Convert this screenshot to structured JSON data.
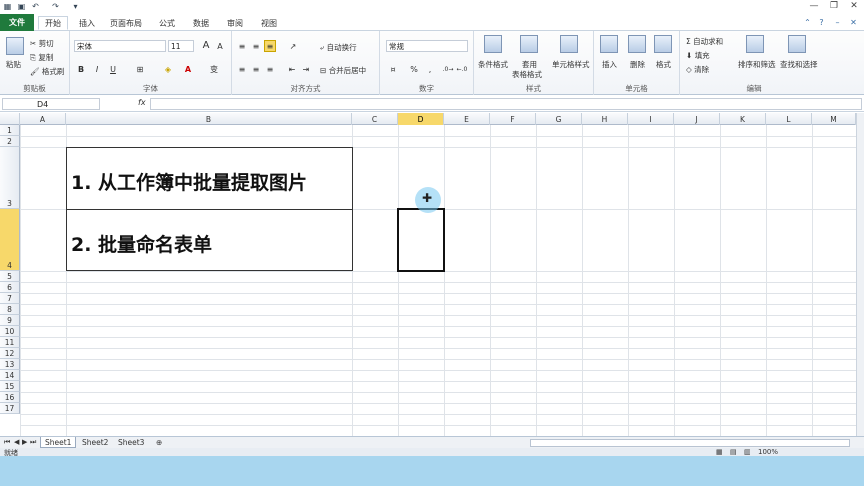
{
  "qat": {
    "dropdown_glyph": "▾"
  },
  "window": {
    "minimize": "—",
    "restore": "❐",
    "close": "✕"
  },
  "tabs": [
    {
      "label": "文件"
    },
    {
      "label": "开始"
    },
    {
      "label": "插入"
    },
    {
      "label": "页面布局"
    },
    {
      "label": "公式"
    },
    {
      "label": "数据"
    },
    {
      "label": "审阅"
    },
    {
      "label": "视图"
    }
  ],
  "ribbon": {
    "clipboard": {
      "paste": "粘贴",
      "cut": "剪切",
      "copy": "复制",
      "format_painter": "格式刷",
      "label": "剪贴板"
    },
    "font": {
      "name": "宋体",
      "size": "11",
      "grow": "A",
      "shrink": "A",
      "bold": "B",
      "italic": "I",
      "underline": "U",
      "label": "字体",
      "phonetic": "变"
    },
    "alignment": {
      "wrap": "自动换行",
      "merge": "合并后居中",
      "label": "对齐方式"
    },
    "number": {
      "format": "常规",
      "percent": "%",
      "comma": ",",
      "label": "数字"
    },
    "styles": {
      "conditional": "条件格式",
      "table_line1": "套用",
      "table_line2": "表格格式",
      "cell_styles": "单元格样式",
      "label": "样式"
    },
    "cells": {
      "insert": "插入",
      "delete": "删除",
      "format": "格式",
      "label": "单元格"
    },
    "editing": {
      "autosum": "自动求和",
      "fill": "填充",
      "clear": "清除",
      "sort": "排序和筛选",
      "find": "查找和选择",
      "label": "编辑"
    }
  },
  "formula_bar": {
    "cell_ref": "D4",
    "fx": "fx",
    "value": ""
  },
  "columns": [
    "A",
    "B",
    "C",
    "D",
    "E",
    "F",
    "G",
    "H",
    "I",
    "J",
    "K",
    "L",
    "M"
  ],
  "rows": [
    "1",
    "2",
    "3",
    "4",
    "5",
    "6",
    "7",
    "8",
    "9",
    "10",
    "11",
    "12",
    "13",
    "14",
    "15",
    "16",
    "17"
  ],
  "selected": {
    "column": "D",
    "row": "4"
  },
  "content": {
    "item1": "1. 从工作簿中批量提取图片",
    "item2": "2. 批量命名表单"
  },
  "sheets": [
    {
      "label": "Sheet1"
    },
    {
      "label": "Sheet2"
    },
    {
      "label": "Sheet3"
    }
  ],
  "status": {
    "ready": "就绪",
    "zoom": "100%"
  },
  "colors": {
    "file_tab": "#1f7a3c",
    "selection_header": "#f7d86a",
    "cursor_highlight": "#78c8f0"
  }
}
